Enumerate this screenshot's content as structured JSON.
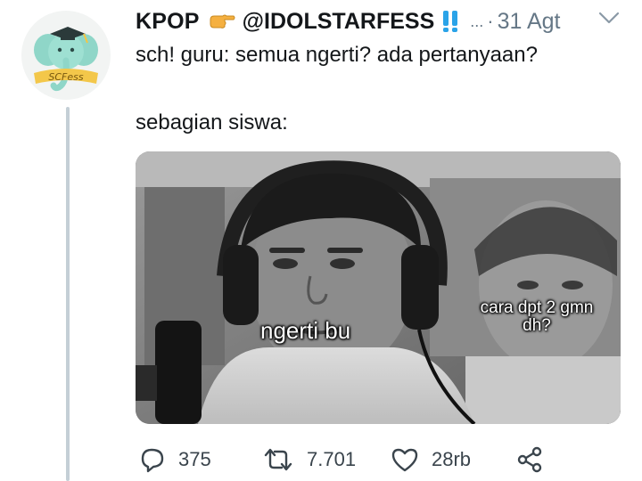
{
  "tweet": {
    "display_name": "KPOP",
    "handle": "@IDOLSTARFESS",
    "date": "31 Agt",
    "ellipsis": "...",
    "dot": "·",
    "line1": "sch! guru: semua ngerti? ada pertanyaan?",
    "line2": "sebagian siswa:",
    "avatar_text": "SCFess"
  },
  "media": {
    "caption_left": "ngerti bu",
    "caption_right": "cara dpt 2 gmn dh?"
  },
  "actions": {
    "replies": "375",
    "retweets": "7.701",
    "likes": "28rb"
  },
  "colors": {
    "text": "#14171a",
    "secondary": "#657786",
    "icon": "#3a444c",
    "avatar_elephant": "#8fd6c8",
    "hand": "#f5b040",
    "bang": "#2aa3e8"
  }
}
